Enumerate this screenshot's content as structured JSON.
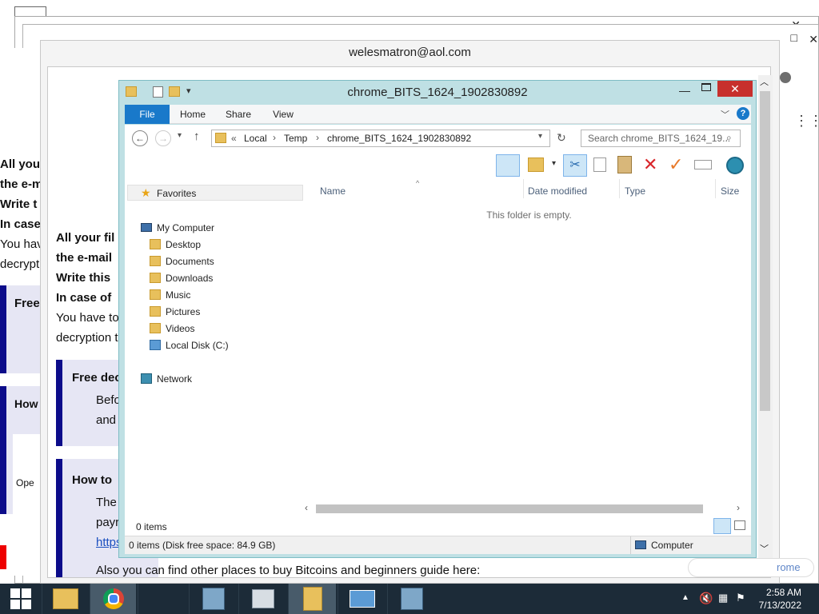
{
  "email_window": {
    "title": "welesmatron@aol.com"
  },
  "ransom_note": {
    "left_lines": [
      "All you",
      "the e-m",
      "Write t",
      "In case",
      "You hav",
      "decrypti"
    ],
    "inner_lines": [
      "All your fil",
      "the e-mail",
      "Write this",
      "In case of",
      "You have to",
      "decryption t"
    ],
    "box1_title": "Free",
    "box2_title": "How",
    "inner_box1_title": "Free dec",
    "inner_box1_lines": [
      "Befo",
      "and"
    ],
    "inner_box2_title": "How to",
    "inner_box2_lines": [
      "The",
      "payr",
      "https"
    ],
    "side_label": "Ope",
    "bottom_line": "Also you can find other places to buy Bitcoins and beginners guide here:",
    "chrome_partial": "rome"
  },
  "explorer": {
    "title": "chrome_BITS_1624_1902830892",
    "tabs": [
      "File",
      "Home",
      "Share",
      "View"
    ],
    "address": {
      "overflow": "«",
      "segments": [
        "Local",
        "Temp",
        "chrome_BITS_1624_1902830892"
      ]
    },
    "search_placeholder": "Search chrome_BITS_1624_19...",
    "columns": [
      "Name",
      "Date modified",
      "Type",
      "Size"
    ],
    "empty_message": "This folder is empty.",
    "nav": {
      "favorites": "Favorites",
      "my_computer": "My Computer",
      "items": [
        "Desktop",
        "Documents",
        "Downloads",
        "Music",
        "Pictures",
        "Videos"
      ],
      "local_disk": "Local Disk (C:)",
      "network": "Network"
    },
    "item_count": "0 items",
    "bottom_status": "0 items (Disk free space: 84.9 GB)",
    "bottom_location": "Computer"
  },
  "taskbar": {
    "time": "2:58 AM",
    "date": "7/13/2022"
  },
  "colors": {
    "accent": "#1979ca",
    "close": "#c7302d",
    "taskbar": "#1c2b38",
    "ransom_blue": "#0c0c8a"
  }
}
